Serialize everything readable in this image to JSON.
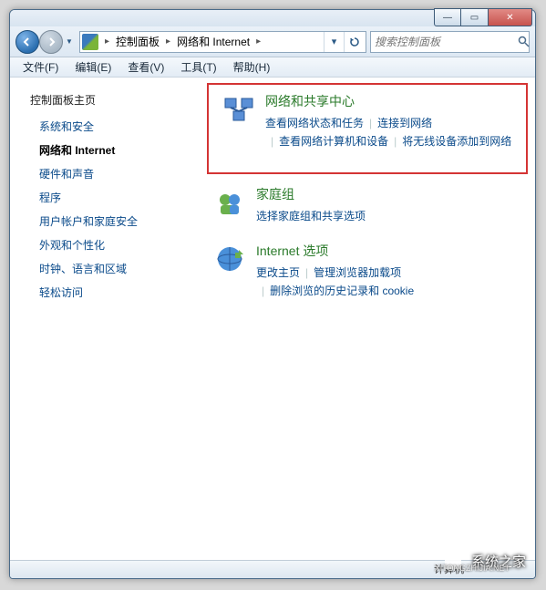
{
  "title_controls": {
    "min": "—",
    "max": "▭",
    "close": "✕"
  },
  "breadcrumb": {
    "seg1": "控制面板",
    "seg2": "网络和 Internet"
  },
  "search": {
    "placeholder": "搜索控制面板"
  },
  "menu": {
    "file": "文件(F)",
    "edit": "编辑(E)",
    "view": "查看(V)",
    "tools": "工具(T)",
    "help": "帮助(H)"
  },
  "sidebar": {
    "title": "控制面板主页",
    "items": [
      "系统和安全",
      "网络和 Internet",
      "硬件和声音",
      "程序",
      "用户帐户和家庭安全",
      "外观和个性化",
      "时钟、语言和区域",
      "轻松访问"
    ],
    "active_index": 1
  },
  "sections": [
    {
      "title": "网络和共享中心",
      "links": [
        "查看网络状态和任务",
        "连接到网络",
        "查看网络计算机和设备",
        "将无线设备添加到网络"
      ],
      "highlighted": true
    },
    {
      "title": "家庭组",
      "links": [
        "选择家庭组和共享选项"
      ],
      "highlighted": false
    },
    {
      "title": "Internet 选项",
      "links": [
        "更改主页",
        "管理浏览器加载项",
        "删除浏览的历史记录和 cookie"
      ],
      "highlighted": false
    }
  ],
  "status": {
    "text": "计算机"
  },
  "watermark": {
    "text": "系统之家",
    "sub": "XITONGZHIJIA.NET"
  }
}
